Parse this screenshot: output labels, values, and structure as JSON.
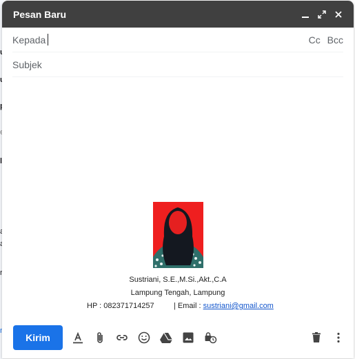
{
  "inbox_background": {
    "peek_letters": [
      "u",
      "u",
      "p",
      "e",
      "l",
      "a",
      "a",
      "r",
      "n"
    ]
  },
  "compose": {
    "title": "Pesan Baru",
    "header_icons": [
      "minimize-icon",
      "expand-icon",
      "close-icon"
    ],
    "to_label": "Kepada",
    "to_value": "",
    "cc_label": "Cc",
    "bcc_label": "Bcc",
    "subject_placeholder": "Subjek",
    "subject_value": ""
  },
  "signature": {
    "name_line": "Sustriani, S.E.,M.Si.,Akt.,C.A",
    "location_line": "Lampung Tengah, Lampung",
    "phone_text": "HP : 082371714257",
    "email_label": "| Email :",
    "email": "sustriani@gmail.com"
  },
  "toolbar": {
    "send_label": "Kirim",
    "tools": [
      "format-text-icon",
      "attach-icon",
      "link-icon",
      "emoji-icon",
      "drive-icon",
      "photo-icon",
      "confidential-icon"
    ],
    "right_tools": [
      "trash-icon",
      "more-options-icon"
    ]
  },
  "colors": {
    "header_bg": "#404040",
    "send_button": "#1a73e8",
    "link": "#1155cc",
    "photo_bg": "#ef1f1f"
  }
}
